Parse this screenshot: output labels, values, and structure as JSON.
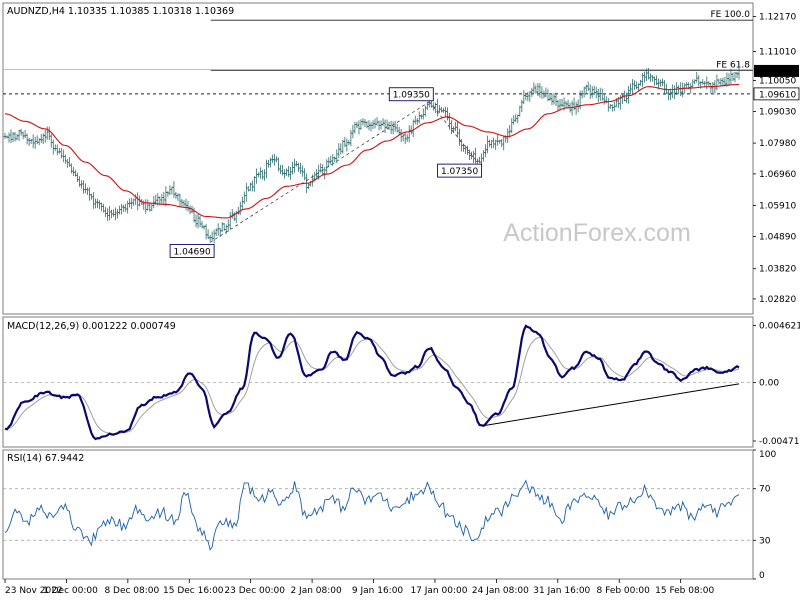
{
  "watermark": "ActionForex.com",
  "colors": {
    "price_bar": "#2e6b6b",
    "ema": "#d01010",
    "macd": "#0a0a6e",
    "macd_signal": "#a0a0a0",
    "rsi": "#1a5faa",
    "frame": "#7c7c7c",
    "tag_text": "#0a0a6e"
  },
  "chart_data": [
    {
      "type": "ohlc",
      "title": "AUDNZD,H4  1.10335 1.10385 1.10318 1.10369",
      "symbol": "AUDNZD",
      "timeframe": "H4",
      "ohlc_header": {
        "open": 1.10335,
        "high": 1.10385,
        "low": 1.10318,
        "close": 1.10369
      },
      "ylim": [
        1.0232,
        1.1262
      ],
      "y_ticks": [
        "1.12170",
        "1.11010",
        "1.10050",
        "1.09030",
        "1.07980",
        "1.06960",
        "1.05910",
        "1.04890",
        "1.03820",
        "1.02820"
      ],
      "y_tick_values": [
        1.1217,
        1.1101,
        1.1005,
        1.0903,
        1.0798,
        1.0696,
        1.0591,
        1.0489,
        1.0382,
        1.0282
      ],
      "x_ticks": [
        "23 Nov 2022",
        "1 Dec 00:00",
        "8 Dec 08:00",
        "15 Dec 16:00",
        "23 Dec 00:00",
        "2 Jan 08:00",
        "9 Jan 16:00",
        "17 Jan 00:00",
        "24 Jan 08:00",
        "31 Jan 16:00",
        "8 Feb 00:00",
        "15 Feb 08:00"
      ],
      "close_anchors": [
        [
          0,
          1.081
        ],
        [
          8,
          1.083
        ],
        [
          14,
          1.0805
        ],
        [
          20,
          1.0825
        ],
        [
          26,
          1.078
        ],
        [
          32,
          1.072
        ],
        [
          38,
          1.066
        ],
        [
          45,
          1.0605
        ],
        [
          52,
          1.0565
        ],
        [
          58,
          1.0585
        ],
        [
          64,
          1.0605
        ],
        [
          71,
          1.0585
        ],
        [
          77,
          1.0615
        ],
        [
          83,
          1.0645
        ],
        [
          89,
          1.059
        ],
        [
          96,
          1.054
        ],
        [
          102,
          1.0485
        ],
        [
          108,
          1.052
        ],
        [
          115,
          1.056
        ],
        [
          121,
          1.0655
        ],
        [
          127,
          1.0695
        ],
        [
          133,
          1.0745
        ],
        [
          139,
          1.0695
        ],
        [
          145,
          1.0725
        ],
        [
          151,
          1.0655
        ],
        [
          157,
          1.0705
        ],
        [
          163,
          1.0745
        ],
        [
          169,
          1.0795
        ],
        [
          175,
          1.0855
        ],
        [
          181,
          1.0865
        ],
        [
          187,
          1.0855
        ],
        [
          193,
          1.0845
        ],
        [
          199,
          1.0815
        ],
        [
          205,
          1.0875
        ],
        [
          211,
          1.0935
        ],
        [
          217,
          1.0905
        ],
        [
          223,
          1.0855
        ],
        [
          229,
          1.0775
        ],
        [
          235,
          1.0745
        ],
        [
          241,
          1.0795
        ],
        [
          247,
          1.0805
        ],
        [
          253,
          1.0865
        ],
        [
          259,
          1.0965
        ],
        [
          265,
          1.0975
        ],
        [
          271,
          1.0945
        ],
        [
          277,
          1.0925
        ],
        [
          283,
          1.0915
        ],
        [
          289,
          1.0975
        ],
        [
          295,
          1.0955
        ],
        [
          301,
          1.0925
        ],
        [
          307,
          1.0945
        ],
        [
          313,
          1.0985
        ],
        [
          319,
          1.1025
        ],
        [
          325,
          1.1005
        ],
        [
          331,
          1.0965
        ],
        [
          337,
          1.0975
        ],
        [
          343,
          1.1005
        ],
        [
          349,
          1.0985
        ],
        [
          355,
          1.0995
        ],
        [
          361,
          1.1015
        ],
        [
          365,
          1.1037
        ]
      ],
      "ema_anchors": [
        [
          0,
          1.0895
        ],
        [
          10,
          1.087
        ],
        [
          20,
          1.0845
        ],
        [
          30,
          1.079
        ],
        [
          40,
          1.0735
        ],
        [
          50,
          1.069
        ],
        [
          60,
          1.064
        ],
        [
          70,
          1.06
        ],
        [
          80,
          1.0595
        ],
        [
          90,
          1.0585
        ],
        [
          100,
          1.0555
        ],
        [
          110,
          1.055
        ],
        [
          120,
          1.058
        ],
        [
          130,
          1.0615
        ],
        [
          140,
          1.0655
        ],
        [
          150,
          1.0665
        ],
        [
          160,
          1.0695
        ],
        [
          170,
          1.0725
        ],
        [
          180,
          1.0775
        ],
        [
          190,
          1.0805
        ],
        [
          200,
          1.0835
        ],
        [
          210,
          1.0865
        ],
        [
          220,
          1.0885
        ],
        [
          230,
          1.0855
        ],
        [
          240,
          1.0835
        ],
        [
          250,
          1.082
        ],
        [
          260,
          1.0845
        ],
        [
          270,
          1.0895
        ],
        [
          280,
          1.0915
        ],
        [
          290,
          1.0925
        ],
        [
          300,
          1.0935
        ],
        [
          310,
          1.0955
        ],
        [
          320,
          1.0985
        ],
        [
          330,
          1.0975
        ],
        [
          340,
          1.098
        ],
        [
          350,
          1.0985
        ],
        [
          365,
          1.0992
        ]
      ],
      "horizontal_levels": [
        {
          "label": "FE 100.0",
          "value": 1.1205,
          "style": "solid",
          "x_start_frac": 0.277
        },
        {
          "label": "FE 61.8",
          "value": 1.1039,
          "style": "solid",
          "x_start_frac": 0.277
        },
        {
          "label": "",
          "value": 1.1042,
          "style": "solid-light",
          "x_start_frac": 0.0
        },
        {
          "label": "",
          "value": 1.0961,
          "style": "dashed",
          "x_start_frac": 0.0
        }
      ],
      "axis_tags": [
        {
          "text": "1.10369",
          "value": 1.1037,
          "style": "filled"
        },
        {
          "text": "1.09610",
          "value": 1.0961,
          "style": "boxed"
        }
      ],
      "callouts": [
        {
          "text": "1.09350",
          "value": 1.0935,
          "bar_index": 211,
          "side": "above"
        },
        {
          "text": "1.07350",
          "value": 1.0735,
          "bar_index": 235,
          "side": "below"
        },
        {
          "text": "1.04690",
          "value": 1.0469,
          "bar_index": 102,
          "side": "below"
        }
      ],
      "wave_lines": [
        {
          "from": [
            102,
            1.0469
          ],
          "to": [
            211,
            1.0935
          ]
        },
        {
          "from": [
            211,
            1.0935
          ],
          "to": [
            235,
            1.0735
          ]
        }
      ],
      "bar_count": 366
    },
    {
      "type": "line",
      "title": "MACD(12,26,9) 0.001222 0.000749",
      "indicator": "MACD",
      "params": [
        12,
        26,
        9
      ],
      "main_value": 0.001222,
      "signal_value": 0.000749,
      "ylim": [
        -0.0052,
        0.0053
      ],
      "y_ticks": [
        "0.004621",
        "0.00",
        "-0.004715"
      ],
      "y_tick_values": [
        0.004621,
        0.0,
        -0.004715
      ],
      "macd_anchors": [
        [
          0,
          -0.0038
        ],
        [
          10,
          -0.0015
        ],
        [
          20,
          -0.0008
        ],
        [
          30,
          -0.0012
        ],
        [
          36,
          -0.001
        ],
        [
          45,
          -0.0045
        ],
        [
          52,
          -0.0042
        ],
        [
          60,
          -0.004
        ],
        [
          68,
          -0.0018
        ],
        [
          75,
          -0.0012
        ],
        [
          85,
          -0.0008
        ],
        [
          92,
          0.0008
        ],
        [
          98,
          -0.0005
        ],
        [
          104,
          -0.0035
        ],
        [
          110,
          -0.0025
        ],
        [
          118,
          -0.0005
        ],
        [
          124,
          0.004
        ],
        [
          130,
          0.0035
        ],
        [
          136,
          0.002
        ],
        [
          142,
          0.004
        ],
        [
          150,
          0.0005
        ],
        [
          157,
          0.001
        ],
        [
          163,
          0.0025
        ],
        [
          169,
          0.0018
        ],
        [
          175,
          0.004
        ],
        [
          181,
          0.0035
        ],
        [
          187,
          0.002
        ],
        [
          193,
          0.0005
        ],
        [
          199,
          0.0008
        ],
        [
          205,
          0.0013
        ],
        [
          211,
          0.0028
        ],
        [
          218,
          0.0012
        ],
        [
          225,
          -0.0005
        ],
        [
          231,
          -0.0018
        ],
        [
          237,
          -0.0035
        ],
        [
          245,
          -0.0025
        ],
        [
          252,
          -0.0005
        ],
        [
          259,
          0.0045
        ],
        [
          265,
          0.004
        ],
        [
          271,
          0.002
        ],
        [
          277,
          0.0005
        ],
        [
          283,
          0.0012
        ],
        [
          289,
          0.0025
        ],
        [
          295,
          0.002
        ],
        [
          301,
          0.0003
        ],
        [
          307,
          0.0002
        ],
        [
          313,
          0.0015
        ],
        [
          319,
          0.0025
        ],
        [
          325,
          0.0015
        ],
        [
          331,
          0.0008
        ],
        [
          337,
          0.0002
        ],
        [
          343,
          0.001
        ],
        [
          349,
          0.0012
        ],
        [
          355,
          0.0008
        ],
        [
          361,
          0.001
        ],
        [
          365,
          0.0013
        ]
      ],
      "trendline": {
        "from": [
          237,
          -0.0035
        ],
        "to": [
          365,
          -0.0001
        ]
      },
      "zero_line": 0.0
    },
    {
      "type": "line",
      "title": "RSI(14) 67.9442",
      "indicator": "RSI",
      "period": 14,
      "current_value": 67.9442,
      "ylim": [
        0,
        100
      ],
      "y_ticks": [
        "100",
        "70",
        "30",
        "0"
      ],
      "y_tick_values": [
        100,
        70,
        30,
        0
      ],
      "levels": [
        70,
        30
      ],
      "rsi_anchors": [
        [
          0,
          38
        ],
        [
          6,
          52
        ],
        [
          12,
          45
        ],
        [
          18,
          55
        ],
        [
          24,
          48
        ],
        [
          30,
          54
        ],
        [
          36,
          38
        ],
        [
          42,
          28
        ],
        [
          48,
          42
        ],
        [
          54,
          45
        ],
        [
          60,
          40
        ],
        [
          66,
          54
        ],
        [
          72,
          48
        ],
        [
          78,
          52
        ],
        [
          84,
          45
        ],
        [
          90,
          65
        ],
        [
          96,
          40
        ],
        [
          102,
          26
        ],
        [
          108,
          44
        ],
        [
          114,
          42
        ],
        [
          120,
          72
        ],
        [
          126,
          62
        ],
        [
          132,
          66
        ],
        [
          138,
          60
        ],
        [
          144,
          72
        ],
        [
          150,
          48
        ],
        [
          156,
          55
        ],
        [
          162,
          62
        ],
        [
          168,
          56
        ],
        [
          174,
          70
        ],
        [
          180,
          60
        ],
        [
          186,
          66
        ],
        [
          192,
          56
        ],
        [
          198,
          60
        ],
        [
          204,
          65
        ],
        [
          210,
          72
        ],
        [
          216,
          58
        ],
        [
          222,
          46
        ],
        [
          228,
          38
        ],
        [
          234,
          30
        ],
        [
          240,
          48
        ],
        [
          246,
          52
        ],
        [
          252,
          62
        ],
        [
          258,
          74
        ],
        [
          264,
          66
        ],
        [
          270,
          60
        ],
        [
          276,
          44
        ],
        [
          282,
          58
        ],
        [
          288,
          66
        ],
        [
          294,
          60
        ],
        [
          300,
          50
        ],
        [
          306,
          56
        ],
        [
          312,
          62
        ],
        [
          318,
          70
        ],
        [
          324,
          58
        ],
        [
          330,
          52
        ],
        [
          336,
          56
        ],
        [
          342,
          46
        ],
        [
          348,
          58
        ],
        [
          354,
          52
        ],
        [
          360,
          60
        ],
        [
          365,
          68
        ]
      ]
    }
  ]
}
